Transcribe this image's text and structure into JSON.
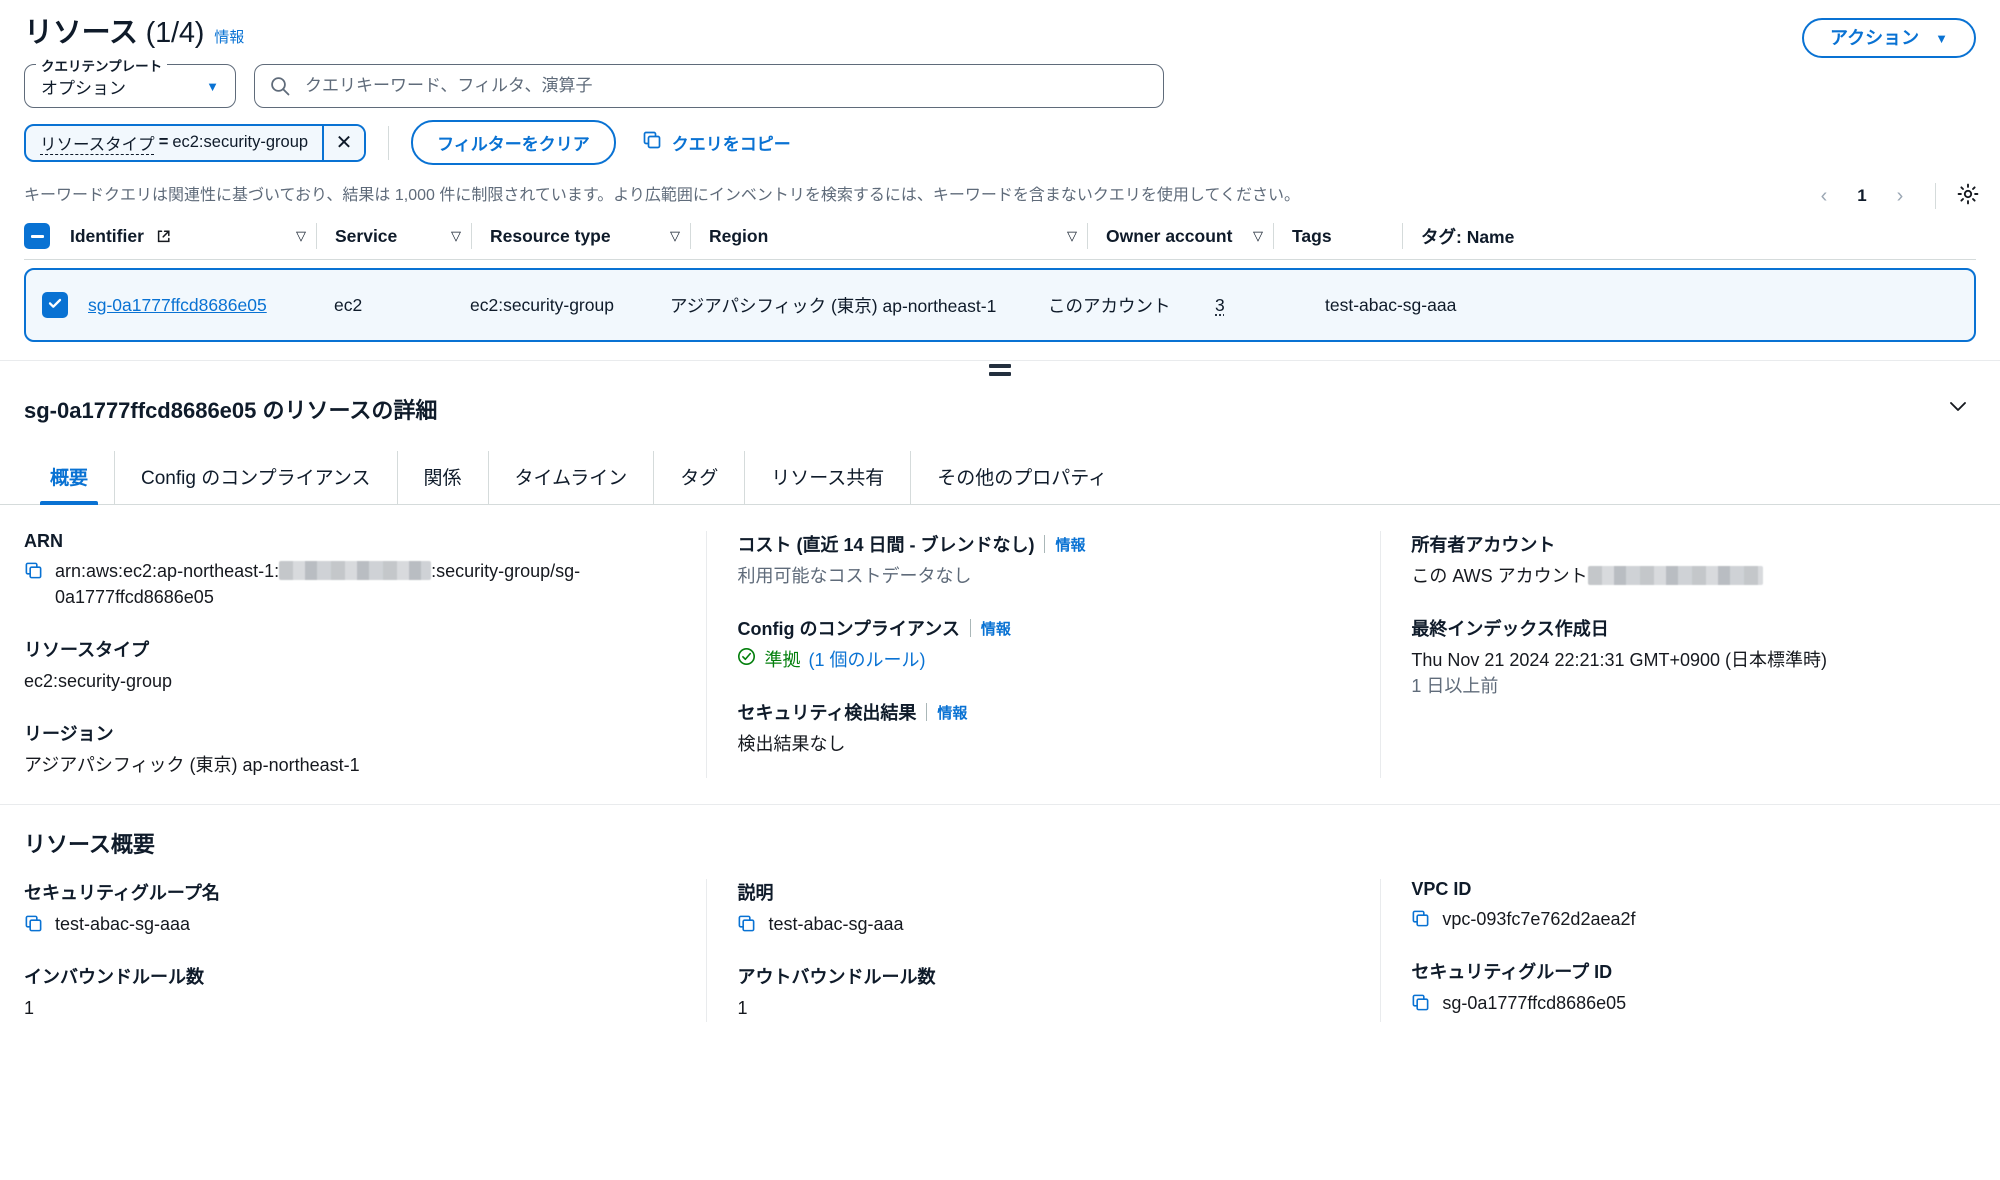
{
  "header": {
    "title": "リソース",
    "count": "(1/4)",
    "info_label": "情報",
    "actions_label": "アクション",
    "actions_caret": "▼"
  },
  "query": {
    "template_legend": "クエリテンプレート",
    "template_value": "オプション",
    "template_caret": "▼",
    "search_placeholder": "クエリキーワード、フィルタ、演算子",
    "search_value": "",
    "search_icon": "search-icon"
  },
  "filters": {
    "token_key": "リソースタイプ",
    "token_operator": "=",
    "token_value": "ec2:security-group",
    "token_dismiss": "✕",
    "clear_label": "フィルターをクリア",
    "copy_query_label": "クエリをコピー"
  },
  "notice": {
    "text": "キーワードクエリは関連性に基づいており、結果は 1,000 件に制限されています。より広範囲にインベントリを検索するには、キーワードを含まないクエリを使用してください。"
  },
  "pagination": {
    "prev": "‹",
    "page": "1",
    "next": "›",
    "settings_icon": "gear-icon"
  },
  "table": {
    "columns": [
      {
        "label": "Identifier",
        "external": true,
        "sortable": true
      },
      {
        "label": "Service",
        "external": false,
        "sortable": true
      },
      {
        "label": "Resource type",
        "external": false,
        "sortable": true
      },
      {
        "label": "Region",
        "external": false,
        "sortable": true
      },
      {
        "label": "Owner account",
        "external": false,
        "sortable": true
      },
      {
        "label": "Tags",
        "external": false,
        "sortable": false
      },
      {
        "label": "タグ: Name",
        "external": false,
        "sortable": false
      }
    ],
    "rows": [
      {
        "selected": true,
        "identifier": "sg-0a1777ffcd8686e05",
        "service": "ec2",
        "resource_type": "ec2:security-group",
        "region": "アジアパシフィック (東京) ap-northeast-1",
        "owner_account": "このアカウント",
        "tags": "3",
        "tag_name": "test-abac-sg-aaa"
      }
    ]
  },
  "detail": {
    "title": "sg-0a1777ffcd8686e05 のリソースの詳細",
    "collapse_icon": "chevron-down-icon",
    "tabs": [
      {
        "label": "概要",
        "active": true
      },
      {
        "label": "Config のコンプライアンス",
        "active": false
      },
      {
        "label": "関係",
        "active": false
      },
      {
        "label": "タイムライン",
        "active": false
      },
      {
        "label": "タグ",
        "active": false
      },
      {
        "label": "リソース共有",
        "active": false
      },
      {
        "label": "その他のプロパティ",
        "active": false
      }
    ],
    "overview": {
      "arn": {
        "label": "ARN",
        "value_prefix": "arn:aws:ec2:ap-northeast-1:",
        "value_suffix": ":security-group/sg-0a1777ffcd8686e05"
      },
      "resource_type": {
        "label": "リソースタイプ",
        "value": "ec2:security-group"
      },
      "region": {
        "label": "リージョン",
        "value": "アジアパシフィック (東京) ap-northeast-1"
      },
      "cost": {
        "label": "コスト (直近 14 日間 - ブレンドなし)",
        "info_label": "情報",
        "value": "利用可能なコストデータなし"
      },
      "config_compliance": {
        "label": "Config のコンプライアンス",
        "info_label": "情報",
        "status": "準拠",
        "rules": "(1 個のルール)",
        "status_icon": "check-circle-icon"
      },
      "security_findings": {
        "label": "セキュリティ検出結果",
        "info_label": "情報",
        "value": "検出結果なし"
      },
      "owner_account": {
        "label": "所有者アカウント",
        "value_prefix": "この AWS アカウント"
      },
      "last_indexed": {
        "label": "最終インデックス作成日",
        "value": "Thu Nov 21 2024 22:21:31 GMT+0900 (日本標準時)",
        "relative": "1 日以上前"
      }
    }
  },
  "resource_summary": {
    "title": "リソース概要",
    "fields": {
      "sg_name": {
        "label": "セキュリティグループ名",
        "value": "test-abac-sg-aaa"
      },
      "inbound": {
        "label": "インバウンドルール数",
        "value": "1"
      },
      "description": {
        "label": "説明",
        "value": "test-abac-sg-aaa"
      },
      "outbound": {
        "label": "アウトバウンドルール数",
        "value": "1"
      },
      "vpc_id": {
        "label": "VPC ID",
        "value": "vpc-093fc7e762d2aea2f"
      },
      "sg_id": {
        "label": "セキュリティグループ ID",
        "value": "sg-0a1777ffcd8686e05"
      }
    }
  },
  "colors": {
    "accent": "#0972d3",
    "selected_row_bg": "#f2f8fd",
    "success": "#037f0c",
    "muted": "#5f6b7a"
  }
}
